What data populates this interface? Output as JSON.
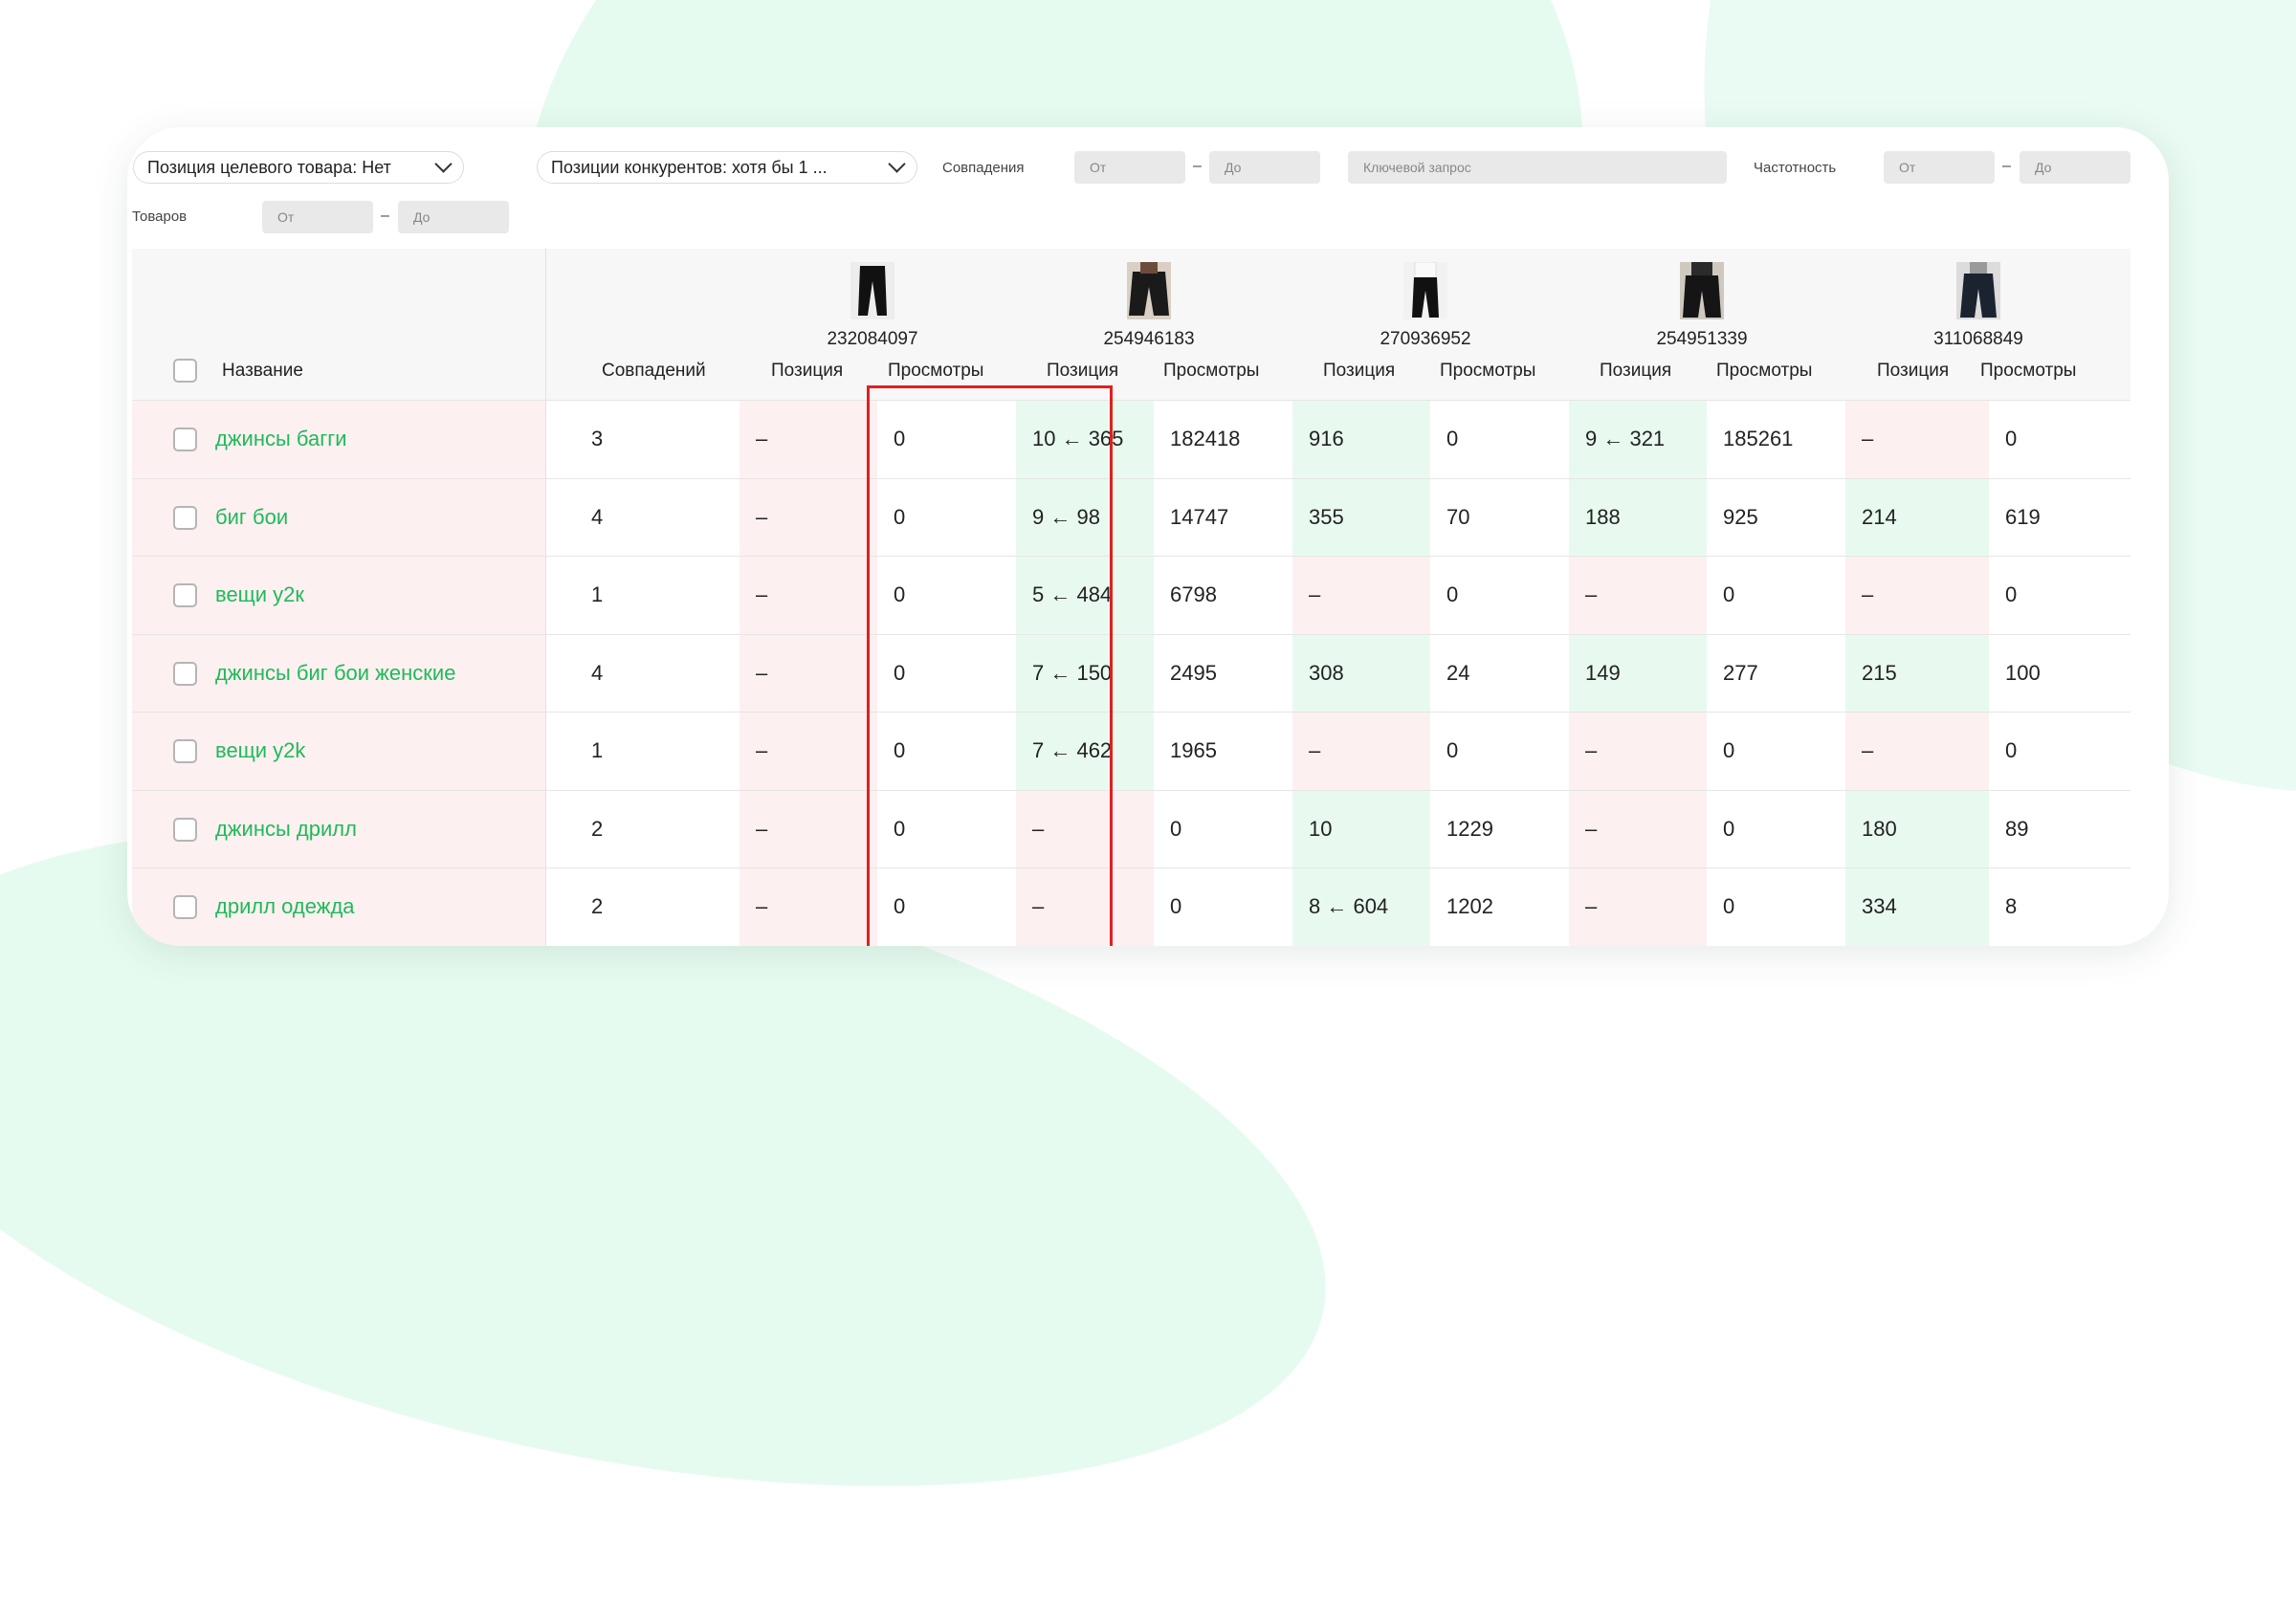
{
  "filters": {
    "target_position": "Позиция целевого товара: Нет",
    "competitors": "Позиции конкурентов: хотя бы 1 ...",
    "matches_label": "Совпадения",
    "from": "От",
    "to": "До",
    "keyword_placeholder": "Ключевой запрос",
    "frequency_label": "Частотность",
    "goods_label": "Товаров",
    "dash": "–"
  },
  "table": {
    "headers": {
      "name": "Название",
      "matches": "Совпадений",
      "position": "Позиция",
      "views": "Просмотры"
    },
    "products": [
      {
        "id": "232084097",
        "thumb_icon": "black-pants-icon"
      },
      {
        "id": "254946183",
        "thumb_icon": "baggy-pants-icon"
      },
      {
        "id": "270936952",
        "thumb_icon": "black-pants-icon"
      },
      {
        "id": "254951339",
        "thumb_icon": "baggy-pants-icon"
      },
      {
        "id": "311068849",
        "thumb_icon": "baggy-pants-icon"
      }
    ],
    "rows": [
      {
        "name": "джинсы багги",
        "matches": "3",
        "cells": [
          {
            "pos": "–",
            "views": "0",
            "tone": "pink"
          },
          {
            "pos": "10 ← 365",
            "views": "182418",
            "tone": "green"
          },
          {
            "pos": "916",
            "views": "0",
            "tone": "green"
          },
          {
            "pos": "9 ← 321",
            "views": "185261",
            "tone": "green"
          },
          {
            "pos": "–",
            "views": "0",
            "tone": "pink"
          }
        ]
      },
      {
        "name": "биг бои",
        "matches": "4",
        "cells": [
          {
            "pos": "–",
            "views": "0",
            "tone": "pink"
          },
          {
            "pos": "9 ← 98",
            "views": "14747",
            "tone": "green"
          },
          {
            "pos": "355",
            "views": "70",
            "tone": "green"
          },
          {
            "pos": "188",
            "views": "925",
            "tone": "green"
          },
          {
            "pos": "214",
            "views": "619",
            "tone": "green"
          }
        ]
      },
      {
        "name": "вещи у2к",
        "matches": "1",
        "cells": [
          {
            "pos": "–",
            "views": "0",
            "tone": "pink"
          },
          {
            "pos": "5 ← 484",
            "views": "6798",
            "tone": "green"
          },
          {
            "pos": "–",
            "views": "0",
            "tone": "pink"
          },
          {
            "pos": "–",
            "views": "0",
            "tone": "pink"
          },
          {
            "pos": "–",
            "views": "0",
            "tone": "pink"
          }
        ]
      },
      {
        "name": "джинсы биг бои женские",
        "matches": "4",
        "cells": [
          {
            "pos": "–",
            "views": "0",
            "tone": "pink"
          },
          {
            "pos": "7 ← 150",
            "views": "2495",
            "tone": "green"
          },
          {
            "pos": "308",
            "views": "24",
            "tone": "green"
          },
          {
            "pos": "149",
            "views": "277",
            "tone": "green"
          },
          {
            "pos": "215",
            "views": "100",
            "tone": "green"
          }
        ]
      },
      {
        "name": "вещи y2k",
        "matches": "1",
        "cells": [
          {
            "pos": "–",
            "views": "0",
            "tone": "pink"
          },
          {
            "pos": "7 ← 462",
            "views": "1965",
            "tone": "green"
          },
          {
            "pos": "–",
            "views": "0",
            "tone": "pink"
          },
          {
            "pos": "–",
            "views": "0",
            "tone": "pink"
          },
          {
            "pos": "–",
            "views": "0",
            "tone": "pink"
          }
        ]
      },
      {
        "name": "джинсы дрилл",
        "matches": "2",
        "cells": [
          {
            "pos": "–",
            "views": "0",
            "tone": "pink"
          },
          {
            "pos": "–",
            "views": "0",
            "tone": "pink"
          },
          {
            "pos": "10",
            "views": "1229",
            "tone": "green"
          },
          {
            "pos": "–",
            "views": "0",
            "tone": "pink"
          },
          {
            "pos": "180",
            "views": "89",
            "tone": "green"
          }
        ]
      },
      {
        "name": "дрилл одежда",
        "matches": "2",
        "cells": [
          {
            "pos": "–",
            "views": "0",
            "tone": "pink"
          },
          {
            "pos": "–",
            "views": "0",
            "tone": "pink"
          },
          {
            "pos": "8 ← 604",
            "views": "1202",
            "tone": "green"
          },
          {
            "pos": "–",
            "views": "0",
            "tone": "pink"
          },
          {
            "pos": "334",
            "views": "8",
            "tone": "green"
          }
        ]
      }
    ]
  },
  "colors": {
    "accent_green": "#1fba5a",
    "highlight_border": "#e02020",
    "cell_pink": "#fdf0f0",
    "cell_green": "#e8faef",
    "background_blob": "#e6fbf0"
  }
}
